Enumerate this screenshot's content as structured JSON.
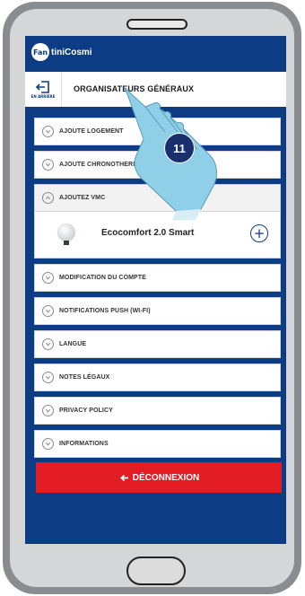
{
  "app": {
    "logo_text": "FantiniCosmi",
    "logo_badge": "Fan"
  },
  "header": {
    "back_label": "EN ARRIÈRE",
    "title": "ORGANISATEURS GÉNÉRAUX"
  },
  "menu": {
    "items": [
      {
        "label": "AJOUTE LOGEMENT"
      },
      {
        "label": "AJOUTE CHRONOTHERMOSTAT / MAINTENANCE"
      },
      {
        "label": "AJOUTEZ VMC"
      }
    ],
    "device": {
      "name": "Ecocomfort 2.0 Smart",
      "action_icon": "plus-circle-icon"
    },
    "items_after": [
      {
        "label": "MODIFICATION DU COMPTE"
      },
      {
        "label": "NOTIFICATIONS PUSH (WI-FI)"
      },
      {
        "label": "LANGUE"
      },
      {
        "label": "NOTES LÉGAUX"
      },
      {
        "label": "PRIVACY POLICY"
      },
      {
        "label": "INFORMATIONS"
      }
    ]
  },
  "logout": {
    "label": "DÉCONNEXION"
  },
  "annotation": {
    "step": "11"
  },
  "colors": {
    "brand_blue": "#0c3d84",
    "logout_red": "#e31b23",
    "badge_navy": "#1a2f6e",
    "hand_blue": "#8fd0e8"
  }
}
